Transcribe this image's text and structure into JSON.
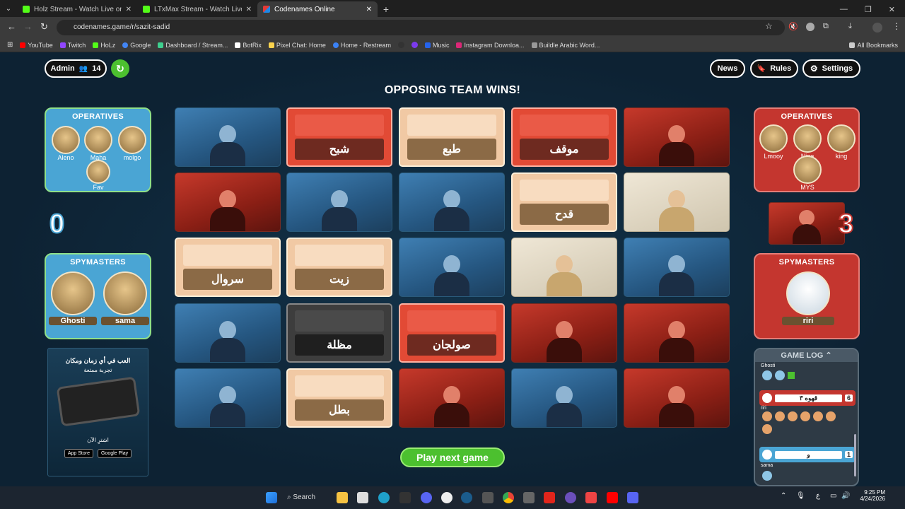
{
  "browser": {
    "tabs": [
      {
        "title": "Holz Stream - Watch Live on Ki",
        "color": "#53fc18"
      },
      {
        "title": "LTxMax Stream - Watch Live on",
        "color": "#53fc18"
      },
      {
        "title": "Codenames Online",
        "color": "#e53935"
      }
    ],
    "url": "codenames.game/r/sazit-sadid",
    "bookmarks": [
      "YouTube",
      "Twitch",
      "HoLz",
      "Google",
      "Dashboard / Stream...",
      "BotRix",
      "Pixel Chat: Home",
      "Home - Restream",
      "Music",
      "Instagram Downloa...",
      "Buildle Arabic Word..."
    ],
    "all_bookmarks": "All Bookmarks"
  },
  "header": {
    "admin_label": "Admin",
    "player_count": "14",
    "news": "News",
    "rules": "Rules",
    "settings": "Settings"
  },
  "banner": "OPPOSING TEAM WINS!",
  "blue_team": {
    "operatives_title": "OPERATIVES",
    "operatives": [
      "Aleno",
      "Maha",
      "molgo",
      "Fav"
    ],
    "score": "0",
    "spymasters_title": "SPYMASTERS",
    "spymasters": [
      "Ghosti",
      "sama"
    ]
  },
  "red_team": {
    "operatives_title": "OPERATIVES",
    "operatives": [
      "Lmooy",
      "Nine",
      "king",
      "MYS"
    ],
    "score": "3",
    "spymasters_title": "SPYMASTERS",
    "spymasters": [
      "riri"
    ]
  },
  "board": [
    {
      "type": "pic",
      "team": "blue"
    },
    {
      "type": "word",
      "team": "red",
      "word": "شبح"
    },
    {
      "type": "word",
      "team": "neutral",
      "word": "طبع"
    },
    {
      "type": "word",
      "team": "red",
      "word": "موقف"
    },
    {
      "type": "pic",
      "team": "red"
    },
    {
      "type": "pic",
      "team": "red"
    },
    {
      "type": "pic",
      "team": "blue"
    },
    {
      "type": "pic",
      "team": "blue"
    },
    {
      "type": "word",
      "team": "neutral",
      "word": "قدح"
    },
    {
      "type": "pic",
      "team": "bystander"
    },
    {
      "type": "word",
      "team": "neutral",
      "word": "سروال"
    },
    {
      "type": "word",
      "team": "neutral",
      "word": "زيت"
    },
    {
      "type": "pic",
      "team": "blue"
    },
    {
      "type": "pic",
      "team": "bystander"
    },
    {
      "type": "pic",
      "team": "blue"
    },
    {
      "type": "pic",
      "team": "blue"
    },
    {
      "type": "word",
      "team": "black",
      "word": "مظلة"
    },
    {
      "type": "word",
      "team": "red",
      "word": "صولجان"
    },
    {
      "type": "pic",
      "team": "red"
    },
    {
      "type": "pic",
      "team": "red"
    },
    {
      "type": "pic",
      "team": "blue"
    },
    {
      "type": "word",
      "team": "neutral",
      "word": "بطل"
    },
    {
      "type": "pic",
      "team": "red"
    },
    {
      "type": "pic",
      "team": "blue"
    },
    {
      "type": "pic",
      "team": "red"
    }
  ],
  "play_next": "Play next game",
  "ad": {
    "headline": "العب في أي زمان ومكان",
    "sub": "تجربة ممتعة",
    "cta": "اشترِ الآن",
    "app_store": "App Store",
    "google_play": "Google Play"
  },
  "game_log": {
    "title": "GAME LOG",
    "clue1_word": "قهوه ٣",
    "clue1_num": "6",
    "clue2_word": "و",
    "clue2_num": "1",
    "names": [
      "Ghosti",
      "riri",
      "sama"
    ]
  },
  "taskbar": {
    "search": "Search",
    "time": "9:25 PM",
    "date": "4/24/2026"
  }
}
